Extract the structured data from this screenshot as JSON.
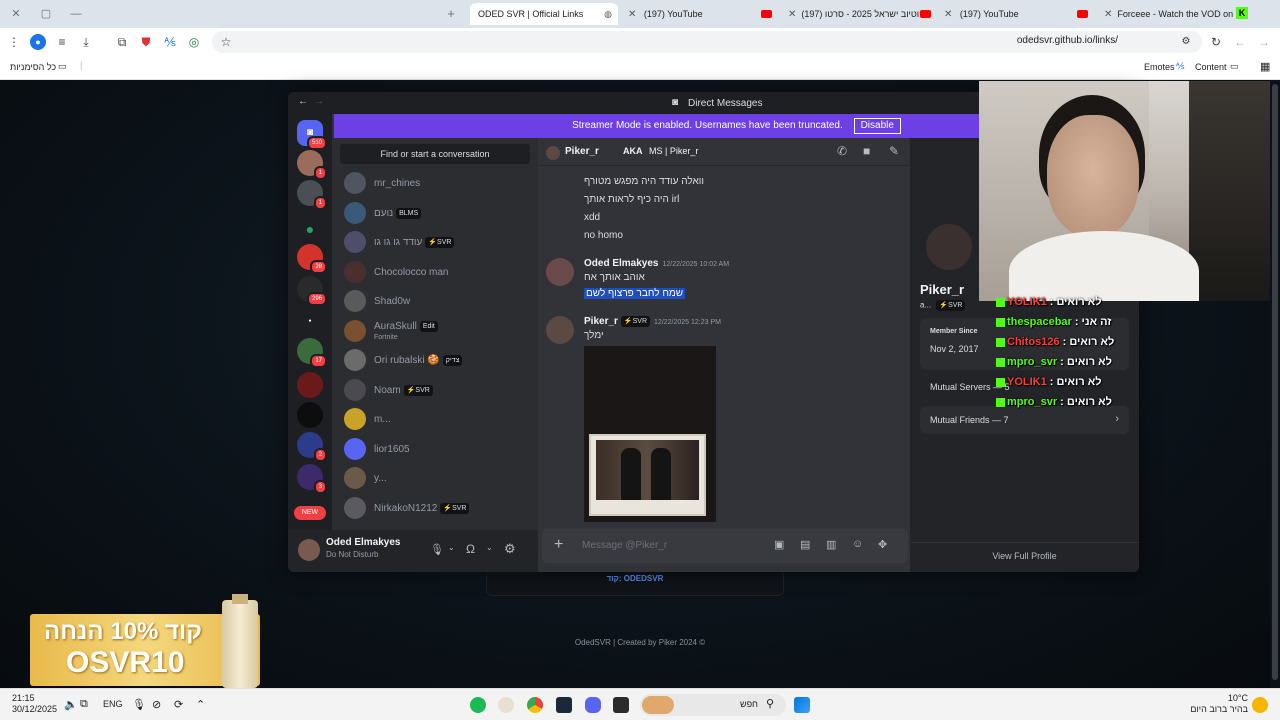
{
  "browser": {
    "tabs": [
      {
        "label": "ODED SVR | Official Links",
        "active": true
      },
      {
        "label": "(197) YouTube"
      },
      {
        "label": "(197) יוטיוב ישראל 2025 - סרטו..."
      },
      {
        "label": "(197) YouTube"
      },
      {
        "label": "Forceee - Watch the VOD on K"
      }
    ],
    "url": "odedsvr.github.io/links/",
    "bookmarks_left": "כל הסימניות",
    "bookmarks_right": [
      "Emotes",
      "Content"
    ]
  },
  "discord": {
    "window_title": "Direct Messages",
    "banner_text": "Streamer Mode is enabled. Usernames have been truncated.",
    "banner_button": "Disable",
    "finder": "Find or start a conversation",
    "guild_badges": [
      "510",
      "1",
      "1",
      "28",
      "296",
      "17",
      "2",
      "3",
      "156"
    ],
    "guild_new": "NEW",
    "dms": [
      {
        "name": "mr_chines",
        "tag": ""
      },
      {
        "name": "נועם",
        "tag": "BLMS"
      },
      {
        "name": "עודד גו גו גו",
        "tag": "⚡SVR"
      },
      {
        "name": "Chocolocco man",
        "tag": ""
      },
      {
        "name": "Shad0w",
        "tag": ""
      },
      {
        "name": "AuraSkull",
        "tag": "Edit",
        "sub": "Fortnite"
      },
      {
        "name": "Ori rubalski 🍪",
        "tag": "צדיק"
      },
      {
        "name": "Noam",
        "tag": "⚡SVR"
      },
      {
        "name": "m...",
        "tag": ""
      },
      {
        "name": "lior1605",
        "tag": ""
      },
      {
        "name": "y...",
        "tag": ""
      },
      {
        "name": "NirkakoN1212",
        "tag": "⚡SVR"
      }
    ],
    "user": {
      "name": "Oded Elmakyes",
      "status": "Do Not Disturb"
    },
    "chat_header": {
      "name": "Piker_r",
      "aka_label": "AKA",
      "aka": "MS | Piker_r"
    },
    "messages_top": [
      "וואלה עודד היה מפגש מטורף",
      "היה כיף לראות אותך irl",
      "xdd",
      "no homo"
    ],
    "msg1": {
      "author": "Oded Elmakyes",
      "time": "12/22/2025 10:02 AM",
      "lines": [
        "אוהב אותך אח"
      ],
      "highlight": "שמח לחבר פרצוף לשם"
    },
    "msg2": {
      "author": "Piker_r",
      "tag": "⚡SVR",
      "time": "12/22/2025 12:23 PM",
      "lines": [
        "ימלך"
      ]
    },
    "input_placeholder": "Message @Piker_r",
    "profile": {
      "name": "Piker_r",
      "short": "a...",
      "tag": "⚡SVR",
      "member_since_label": "Member Since",
      "member_since": "Nov 2, 2017",
      "mutual_servers": "Mutual Servers — 5",
      "mutual_friends": "Mutual Friends — 7",
      "view_full": "View Full Profile"
    }
  },
  "stream_chat": [
    {
      "user": "YOLIK1",
      "text": ": לא רואים",
      "color": "#ff3b3b"
    },
    {
      "user": "thespacebar",
      "text": ": זה אני",
      "color": "#53fc18"
    },
    {
      "user": "Chitos126",
      "text": ": לא רואים",
      "color": "#ff3b3b"
    },
    {
      "user": "mpro_svr",
      "text": ": לא רואים",
      "color": "#53fc18"
    },
    {
      "user": "YOLIK1",
      "text": ": לא רואים",
      "color": "#ff3b3b"
    },
    {
      "user": "mpro_svr",
      "text": ": לא רואים",
      "color": "#53fc18"
    }
  ],
  "page": {
    "code_line": "קוד: ODEDSVR",
    "footer": "OdedSVR | Created by Piker 2024 ©",
    "promo": {
      "line1": "קוד 10% הנחה",
      "line2": "OSVR10"
    }
  },
  "taskbar": {
    "time": "21:15",
    "date": "30/12/2025",
    "lang": "ENG",
    "search": "חפש",
    "weather_temp": "10°C",
    "weather_text": "בהיר ברוב היום"
  }
}
